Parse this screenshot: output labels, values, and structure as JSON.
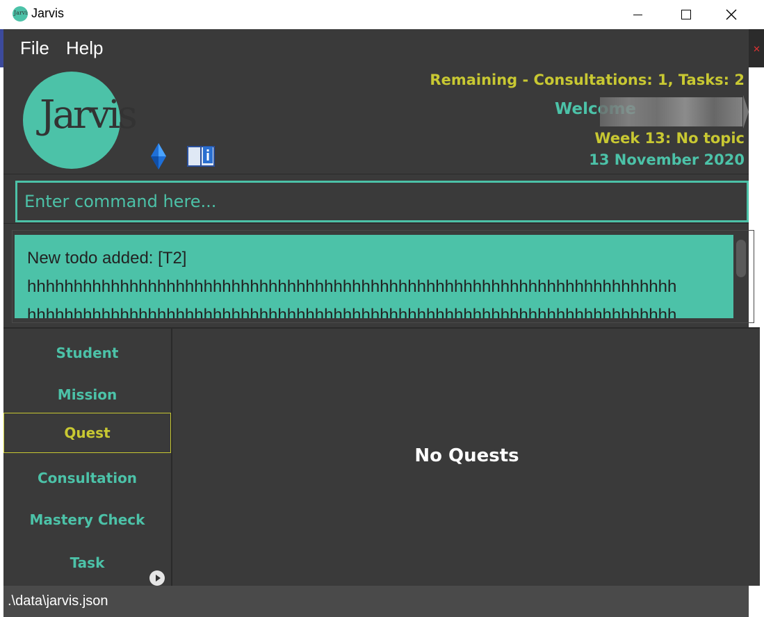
{
  "window": {
    "title": "Jarvis",
    "title_icon_text": "Jarvis"
  },
  "menu": {
    "items": [
      {
        "label": "File"
      },
      {
        "label": "Help"
      }
    ]
  },
  "header": {
    "logo_text": "Jarvis",
    "remaining": "Remaining - Consultations: 1, Tasks: 2",
    "welcome": "Welcome",
    "week": "Week 13: No topic",
    "date": "13 November 2020"
  },
  "command": {
    "placeholder": "Enter command here..."
  },
  "result": {
    "lines": [
      "New todo added: [T2]",
      "hhhhhhhhhhhhhhhhhhhhhhhhhhhhhhhhhhhhhhhhhhhhhhhhhhhhhhhhhhhhhhhhhhhhhh",
      "hhhhhhhhhhhhhhhhhhhhhhhhhhhhhhhhhhhhhhhhhhhhhhhhhhhhhhhhhhhhhhhhhhhhhh"
    ]
  },
  "sidebar": {
    "tabs": [
      {
        "label": "Student"
      },
      {
        "label": "Mission"
      },
      {
        "label": "Quest"
      },
      {
        "label": "Consultation"
      },
      {
        "label": "Mastery Check"
      },
      {
        "label": "Task"
      }
    ],
    "active": "Quest"
  },
  "content": {
    "empty_message": "No Quests"
  },
  "status": {
    "path": ".\\data\\jarvis.json"
  },
  "colors": {
    "accent": "#4cc2a8",
    "highlight": "#c8c832",
    "background": "#3a3a3a"
  }
}
